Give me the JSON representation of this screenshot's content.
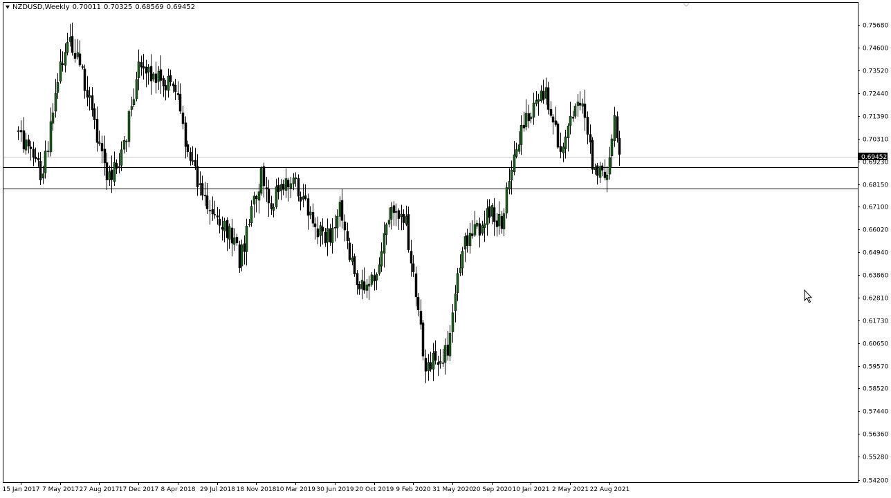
{
  "header": {
    "symbol": "NZDUSD,Weekly",
    "open": "0.70011",
    "high": "0.70325",
    "low": "0.68569",
    "close": "0.69452"
  },
  "chart_data": {
    "type": "candlestick",
    "symbol": "NZDUSD",
    "timeframe": "Weekly",
    "ylim": [
      0.5417,
      0.7618
    ],
    "y_ticks": [
      "0.75680",
      "0.74600",
      "0.73520",
      "0.72440",
      "0.71390",
      "0.70310",
      "0.69230",
      "0.68150",
      "0.67100",
      "0.66020",
      "0.64940",
      "0.63860",
      "0.62810",
      "0.61730",
      "0.60650",
      "0.59570",
      "0.58520",
      "0.57440",
      "0.56360",
      "0.55280",
      "0.54200"
    ],
    "x_ticks": [
      "15 Jan 2017",
      "7 May 2017",
      "27 Aug 2017",
      "17 Dec 2017",
      "8 Apr 2018",
      "29 Jul 2018",
      "18 Nov 2018",
      "10 Mar 2019",
      "30 Jun 2019",
      "20 Oct 2019",
      "9 Feb 2020",
      "31 May 2020",
      "20 Sep 2020",
      "10 Jan 2021",
      "2 May 2021",
      "22 Aug 2021"
    ],
    "current_price": "0.69452",
    "horizontal_lines": [
      0.6897,
      0.6795
    ],
    "grid": false,
    "anchors": [
      [
        "15 Jan 2017",
        0.705
      ],
      [
        "20 Mar 2017",
        0.686
      ],
      [
        "2 May 2017",
        0.733
      ],
      [
        "28 May 2017",
        0.752
      ],
      [
        "15 Jul 2017",
        0.73
      ],
      [
        "15 Aug 2017",
        0.708
      ],
      [
        "15 Sep 2017",
        0.684
      ],
      [
        "1 Nov 2017",
        0.695
      ],
      [
        "15 Dec 2017",
        0.735
      ],
      [
        "30 Jan 2018",
        0.733
      ],
      [
        "1 Apr 2018",
        0.728
      ],
      [
        "15 May 2018",
        0.69
      ],
      [
        "20 Jun 2018",
        0.676
      ],
      [
        "30 Aug 2018",
        0.66
      ],
      [
        "1 Oct 2018",
        0.646
      ],
      [
        "5 Dec 2018",
        0.686
      ],
      [
        "1 Jan 2019",
        0.673
      ],
      [
        "1 Mar 2019",
        0.685
      ],
      [
        "1 May 2019",
        0.662
      ],
      [
        "10 Jun 2019",
        0.656
      ],
      [
        "15 Jul 2019",
        0.672
      ],
      [
        "1 Sep 2019",
        0.633
      ],
      [
        "15 Oct 2019",
        0.635
      ],
      [
        "15 Dec 2019",
        0.672
      ],
      [
        "20 Jan 2020",
        0.662
      ],
      [
        "15 Mar 2020",
        0.595
      ],
      [
        "1 Apr 2020",
        0.597
      ],
      [
        "15 May 2020",
        0.601
      ],
      [
        "1 Jul 2020",
        0.655
      ],
      [
        "15 Aug 2020",
        0.661
      ],
      [
        "10 Sep 2020",
        0.671
      ],
      [
        "20 Oct 2020",
        0.662
      ],
      [
        "10 Nov 2020",
        0.689
      ],
      [
        "20 Dec 2020",
        0.712
      ],
      [
        "20 Feb 2021",
        0.723
      ],
      [
        "1 Apr 2021",
        0.699
      ],
      [
        "1 Jun 2021",
        0.719
      ],
      [
        "1 Jul 2021",
        0.693
      ],
      [
        "20 Aug 2021",
        0.685
      ],
      [
        "1 Sep 2021",
        0.715
      ],
      [
        "25 Sep 2021",
        0.6945
      ]
    ],
    "series": [
      {
        "name": "up",
        "color": "#1a5e1a"
      },
      {
        "name": "down",
        "color": "#000000"
      }
    ]
  },
  "icons": {
    "menu": "triangle-down-icon",
    "cursor": "arrow-pointer-icon"
  }
}
